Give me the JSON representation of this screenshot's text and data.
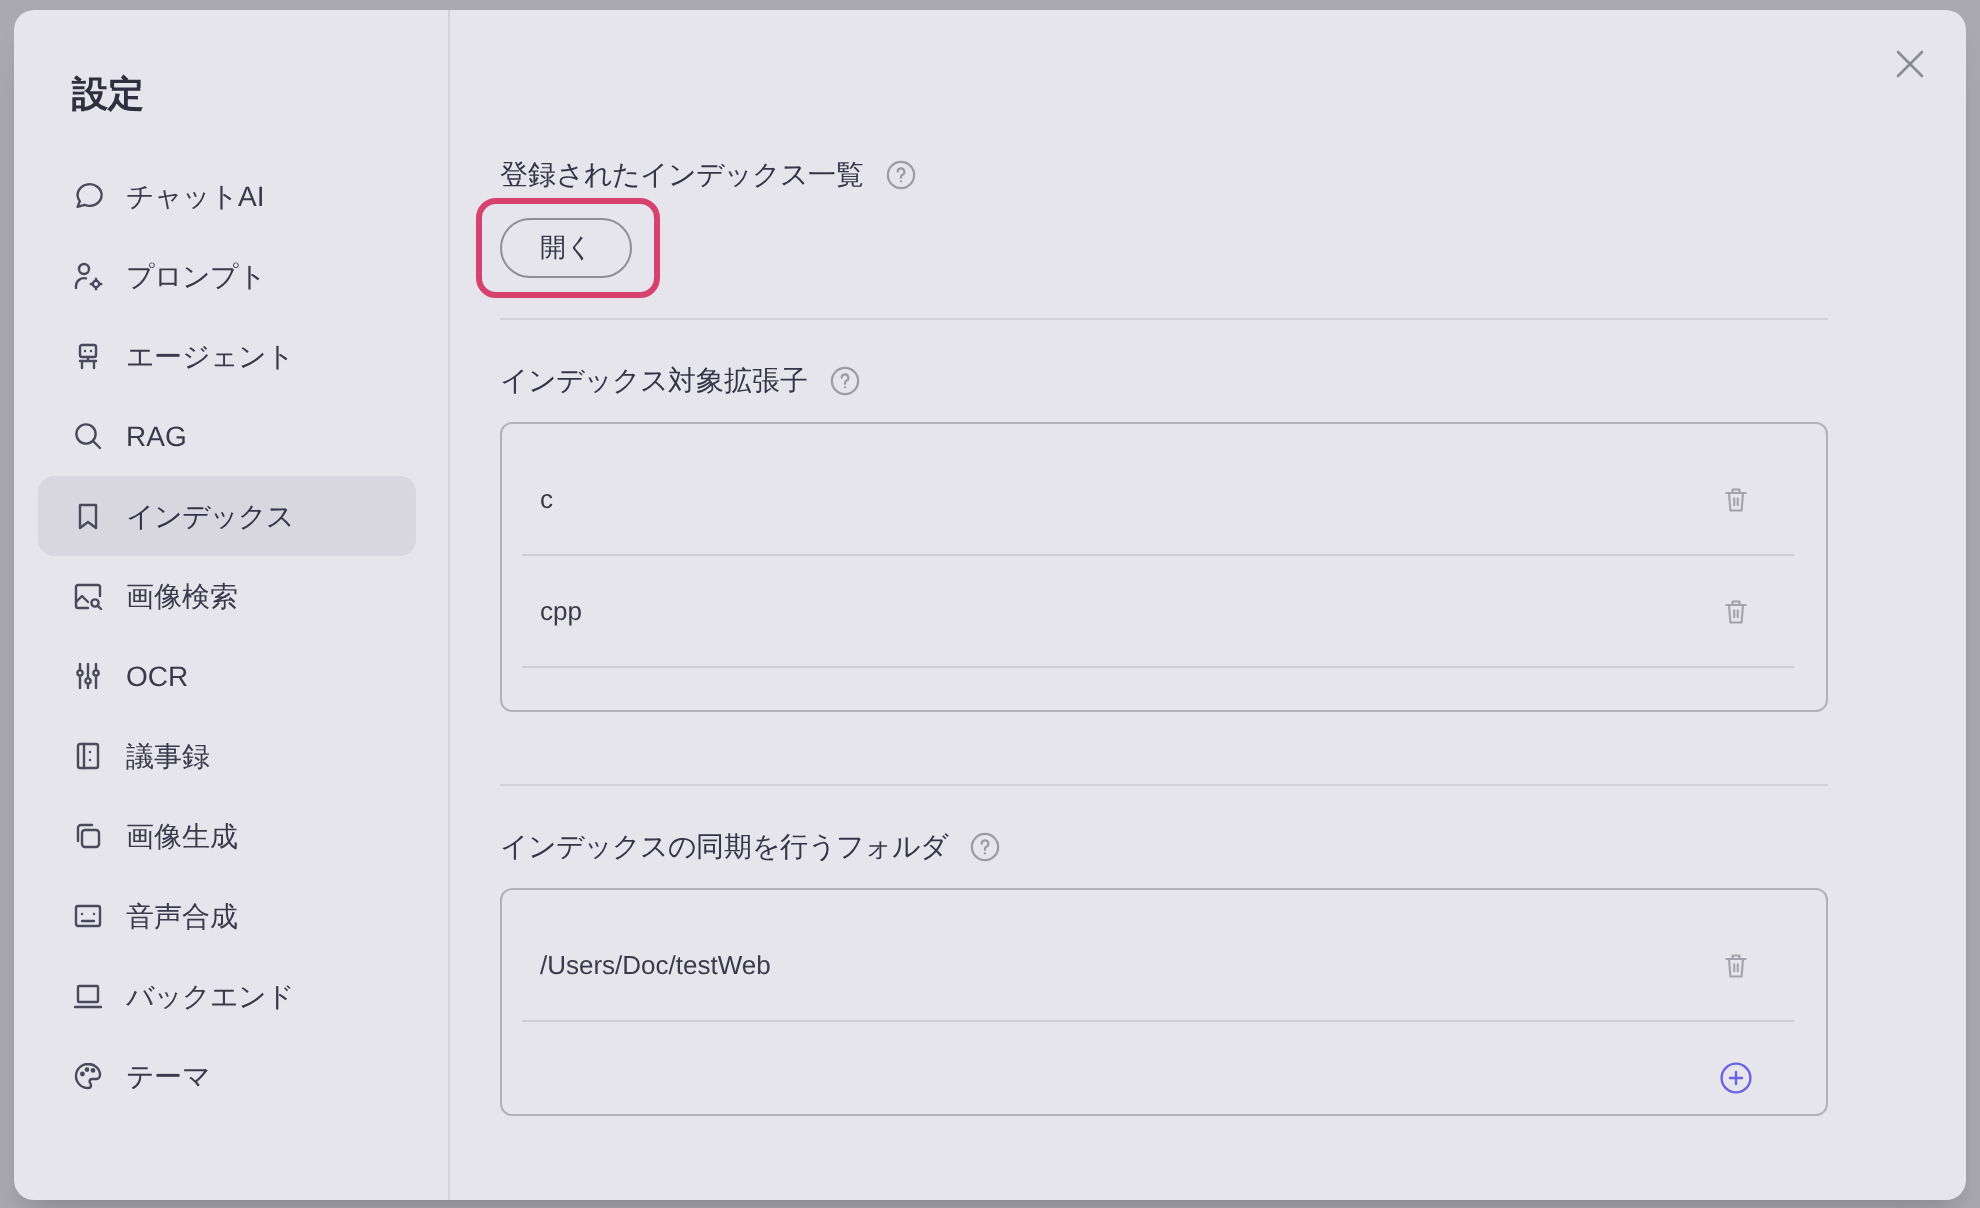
{
  "title": "設定",
  "sidebar": {
    "items": [
      {
        "label": "チャットAI",
        "selected": false
      },
      {
        "label": "プロンプト",
        "selected": false
      },
      {
        "label": "エージェント",
        "selected": false
      },
      {
        "label": "RAG",
        "selected": false
      },
      {
        "label": "インデックス",
        "selected": true
      },
      {
        "label": "画像検索",
        "selected": false
      },
      {
        "label": "OCR",
        "selected": false
      },
      {
        "label": "議事録",
        "selected": false
      },
      {
        "label": "画像生成",
        "selected": false
      },
      {
        "label": "音声合成",
        "selected": false
      },
      {
        "label": "バックエンド",
        "selected": false
      },
      {
        "label": "テーマ",
        "selected": false
      }
    ]
  },
  "sections": [
    {
      "kind": "button",
      "title": "登録されたインデックス一覧",
      "button": {
        "label": "開く",
        "highlighted": true
      }
    },
    {
      "kind": "list",
      "title": "インデックス対象拡張子",
      "items": [
        "c",
        "cpp"
      ],
      "can_add": false
    },
    {
      "kind": "list",
      "title": "インデックスの同期を行うフォルダ",
      "items": [
        "/Users/Doc/testWeb"
      ],
      "can_add": true
    }
  ]
}
